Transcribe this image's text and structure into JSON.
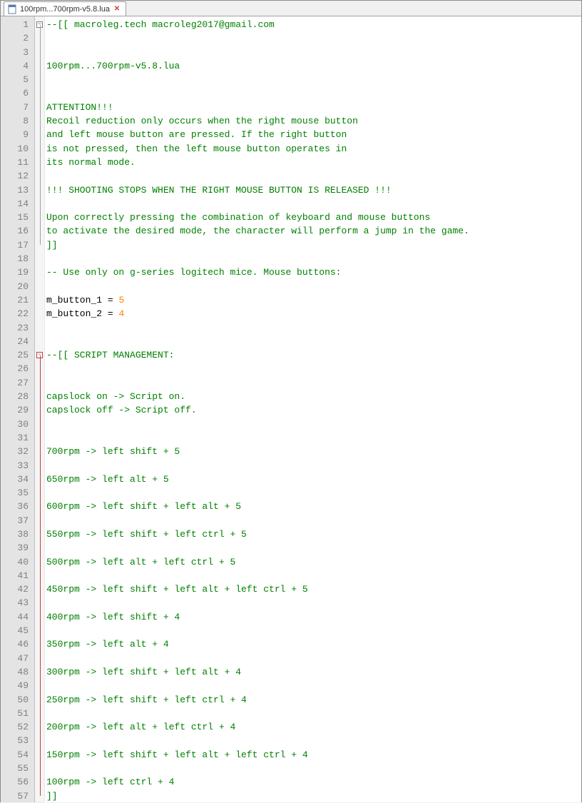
{
  "tab": {
    "label": "100rpm...700rpm-v5.8.lua",
    "close_glyph": "✕"
  },
  "lines": [
    {
      "n": 1,
      "fold": "minus",
      "segs": [
        {
          "cls": "tk-comment",
          "t": "--[[ macroleg.tech macroleg2017@gmail.com"
        }
      ]
    },
    {
      "n": 2,
      "fold": "line",
      "segs": []
    },
    {
      "n": 3,
      "fold": "line",
      "segs": []
    },
    {
      "n": 4,
      "fold": "line",
      "segs": [
        {
          "cls": "tk-comment",
          "t": "100rpm...700rpm-v5.8.lua"
        }
      ]
    },
    {
      "n": 5,
      "fold": "line",
      "segs": []
    },
    {
      "n": 6,
      "fold": "line",
      "segs": []
    },
    {
      "n": 7,
      "fold": "line",
      "segs": [
        {
          "cls": "tk-comment",
          "t": "ATTENTION!!!"
        }
      ]
    },
    {
      "n": 8,
      "fold": "line",
      "segs": [
        {
          "cls": "tk-comment",
          "t": "Recoil reduction only occurs when the right mouse button"
        }
      ]
    },
    {
      "n": 9,
      "fold": "line",
      "segs": [
        {
          "cls": "tk-comment",
          "t": "and left mouse button are pressed. If the right button"
        }
      ]
    },
    {
      "n": 10,
      "fold": "line",
      "segs": [
        {
          "cls": "tk-comment",
          "t": "is not pressed, then the left mouse button operates in"
        }
      ]
    },
    {
      "n": 11,
      "fold": "line",
      "segs": [
        {
          "cls": "tk-comment",
          "t": "its normal mode."
        }
      ]
    },
    {
      "n": 12,
      "fold": "line",
      "segs": []
    },
    {
      "n": 13,
      "fold": "line",
      "segs": [
        {
          "cls": "tk-comment",
          "t": "!!! SHOOTING STOPS WHEN THE RIGHT MOUSE BUTTON IS RELEASED !!!"
        }
      ]
    },
    {
      "n": 14,
      "fold": "line",
      "segs": []
    },
    {
      "n": 15,
      "fold": "line",
      "segs": [
        {
          "cls": "tk-comment",
          "t": "Upon correctly pressing the combination of keyboard and mouse buttons"
        }
      ]
    },
    {
      "n": 16,
      "fold": "line",
      "segs": [
        {
          "cls": "tk-comment",
          "t": "to activate the desired mode, the character will perform a jump in the game."
        }
      ]
    },
    {
      "n": 17,
      "fold": "end",
      "segs": [
        {
          "cls": "tk-comment",
          "t": "]]"
        }
      ]
    },
    {
      "n": 18,
      "fold": "",
      "segs": []
    },
    {
      "n": 19,
      "fold": "",
      "segs": [
        {
          "cls": "tk-comment",
          "t": "-- Use only on g-series logitech mice. Mouse buttons:"
        }
      ]
    },
    {
      "n": 20,
      "fold": "",
      "segs": []
    },
    {
      "n": 21,
      "fold": "",
      "segs": [
        {
          "cls": "tk-var",
          "t": "m_button_1 "
        },
        {
          "cls": "tk-op",
          "t": "= "
        },
        {
          "cls": "tk-num",
          "t": "5"
        }
      ]
    },
    {
      "n": 22,
      "fold": "",
      "segs": [
        {
          "cls": "tk-var",
          "t": "m_button_2 "
        },
        {
          "cls": "tk-op",
          "t": "= "
        },
        {
          "cls": "tk-num",
          "t": "4"
        }
      ]
    },
    {
      "n": 23,
      "fold": "",
      "segs": []
    },
    {
      "n": 24,
      "fold": "",
      "segs": []
    },
    {
      "n": 25,
      "fold": "minus-red",
      "segs": [
        {
          "cls": "tk-comment",
          "t": "--[[ SCRIPT MANAGEMENT:"
        }
      ]
    },
    {
      "n": 26,
      "fold": "line-red",
      "segs": []
    },
    {
      "n": 27,
      "fold": "line-red",
      "segs": []
    },
    {
      "n": 28,
      "fold": "line-red",
      "segs": [
        {
          "cls": "tk-comment",
          "t": "capslock on -> Script on."
        }
      ]
    },
    {
      "n": 29,
      "fold": "line-red",
      "segs": [
        {
          "cls": "tk-comment",
          "t": "capslock off -> Script off."
        }
      ]
    },
    {
      "n": 30,
      "fold": "line-red",
      "segs": []
    },
    {
      "n": 31,
      "fold": "line-red",
      "segs": []
    },
    {
      "n": 32,
      "fold": "line-red",
      "segs": [
        {
          "cls": "tk-comment",
          "t": "700rpm -> left shift + 5"
        }
      ]
    },
    {
      "n": 33,
      "fold": "line-red",
      "segs": []
    },
    {
      "n": 34,
      "fold": "line-red",
      "segs": [
        {
          "cls": "tk-comment",
          "t": "650rpm -> left alt + 5"
        }
      ]
    },
    {
      "n": 35,
      "fold": "line-red",
      "segs": []
    },
    {
      "n": 36,
      "fold": "line-red",
      "segs": [
        {
          "cls": "tk-comment",
          "t": "600rpm -> left shift + left alt + 5"
        }
      ]
    },
    {
      "n": 37,
      "fold": "line-red",
      "segs": []
    },
    {
      "n": 38,
      "fold": "line-red",
      "segs": [
        {
          "cls": "tk-comment",
          "t": "550rpm -> left shift + left ctrl + 5"
        }
      ]
    },
    {
      "n": 39,
      "fold": "line-red",
      "segs": []
    },
    {
      "n": 40,
      "fold": "line-red",
      "segs": [
        {
          "cls": "tk-comment",
          "t": "500rpm -> left alt + left ctrl + 5"
        }
      ]
    },
    {
      "n": 41,
      "fold": "line-red",
      "segs": []
    },
    {
      "n": 42,
      "fold": "line-red",
      "segs": [
        {
          "cls": "tk-comment",
          "t": "450rpm -> left shift + left alt + left ctrl + 5"
        }
      ]
    },
    {
      "n": 43,
      "fold": "line-red",
      "segs": []
    },
    {
      "n": 44,
      "fold": "line-red",
      "segs": [
        {
          "cls": "tk-comment",
          "t": "400rpm -> left shift + 4"
        }
      ]
    },
    {
      "n": 45,
      "fold": "line-red",
      "segs": []
    },
    {
      "n": 46,
      "fold": "line-red",
      "segs": [
        {
          "cls": "tk-comment",
          "t": "350rpm -> left alt + 4"
        }
      ]
    },
    {
      "n": 47,
      "fold": "line-red",
      "segs": []
    },
    {
      "n": 48,
      "fold": "line-red",
      "segs": [
        {
          "cls": "tk-comment",
          "t": "300rpm -> left shift + left alt + 4"
        }
      ]
    },
    {
      "n": 49,
      "fold": "line-red",
      "segs": []
    },
    {
      "n": 50,
      "fold": "line-red",
      "segs": [
        {
          "cls": "tk-comment",
          "t": "250rpm -> left shift + left ctrl + 4"
        }
      ]
    },
    {
      "n": 51,
      "fold": "line-red",
      "segs": []
    },
    {
      "n": 52,
      "fold": "line-red",
      "segs": [
        {
          "cls": "tk-comment",
          "t": "200rpm -> left alt + left ctrl + 4"
        }
      ]
    },
    {
      "n": 53,
      "fold": "line-red",
      "segs": []
    },
    {
      "n": 54,
      "fold": "line-red",
      "segs": [
        {
          "cls": "tk-comment",
          "t": "150rpm -> left shift + left alt + left ctrl + 4"
        }
      ]
    },
    {
      "n": 55,
      "fold": "line-red",
      "segs": []
    },
    {
      "n": 56,
      "fold": "line-red",
      "segs": [
        {
          "cls": "tk-comment",
          "t": "100rpm -> left ctrl + 4"
        }
      ]
    },
    {
      "n": 57,
      "fold": "end-red",
      "segs": [
        {
          "cls": "tk-comment",
          "t": "]]"
        }
      ]
    }
  ]
}
